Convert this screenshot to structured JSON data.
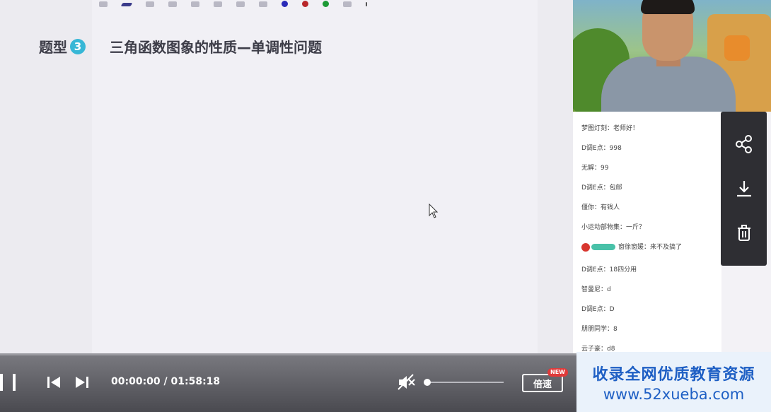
{
  "slide": {
    "heading_prefix": "题型",
    "heading_number": "3",
    "heading_title": "三角函数图象的性质—单调性问题"
  },
  "chat": {
    "messages": [
      {
        "text": "梦图灯刻：老师好！"
      },
      {
        "text": "D调E点：998"
      },
      {
        "text": "无解：99"
      },
      {
        "text": "D调E点：包邮"
      },
      {
        "text": "僵你：有钱人"
      },
      {
        "text": "小运动部物集：一斤？"
      },
      {
        "text": "窗徐窗媛：来不及搞了",
        "has_badge": true
      },
      {
        "text": "D调E点：18四分用"
      },
      {
        "text": "智曼尼：d"
      },
      {
        "text": "D调E点：D"
      },
      {
        "text": "朋朋同学：8"
      },
      {
        "text": "云子豪：d8"
      }
    ]
  },
  "controls": {
    "time_display": "00:00:00 / 01:58:18",
    "speed_label": "倍速",
    "new_badge": "NEW",
    "progress_fraction": 0.0,
    "volume_fraction": 0.0
  },
  "watermark": {
    "line1": "收录全网优质教育资源",
    "line2": "www.52xueba.com"
  },
  "colors": {
    "accent_blue": "#37b7d6",
    "watermark_blue": "#1e5fc4",
    "new_red": "#e03a3a"
  },
  "icons": {
    "side": [
      "share-icon",
      "download-icon",
      "trash-icon"
    ],
    "player": [
      "pause-icon",
      "previous-icon",
      "next-icon",
      "mute-icon"
    ]
  }
}
